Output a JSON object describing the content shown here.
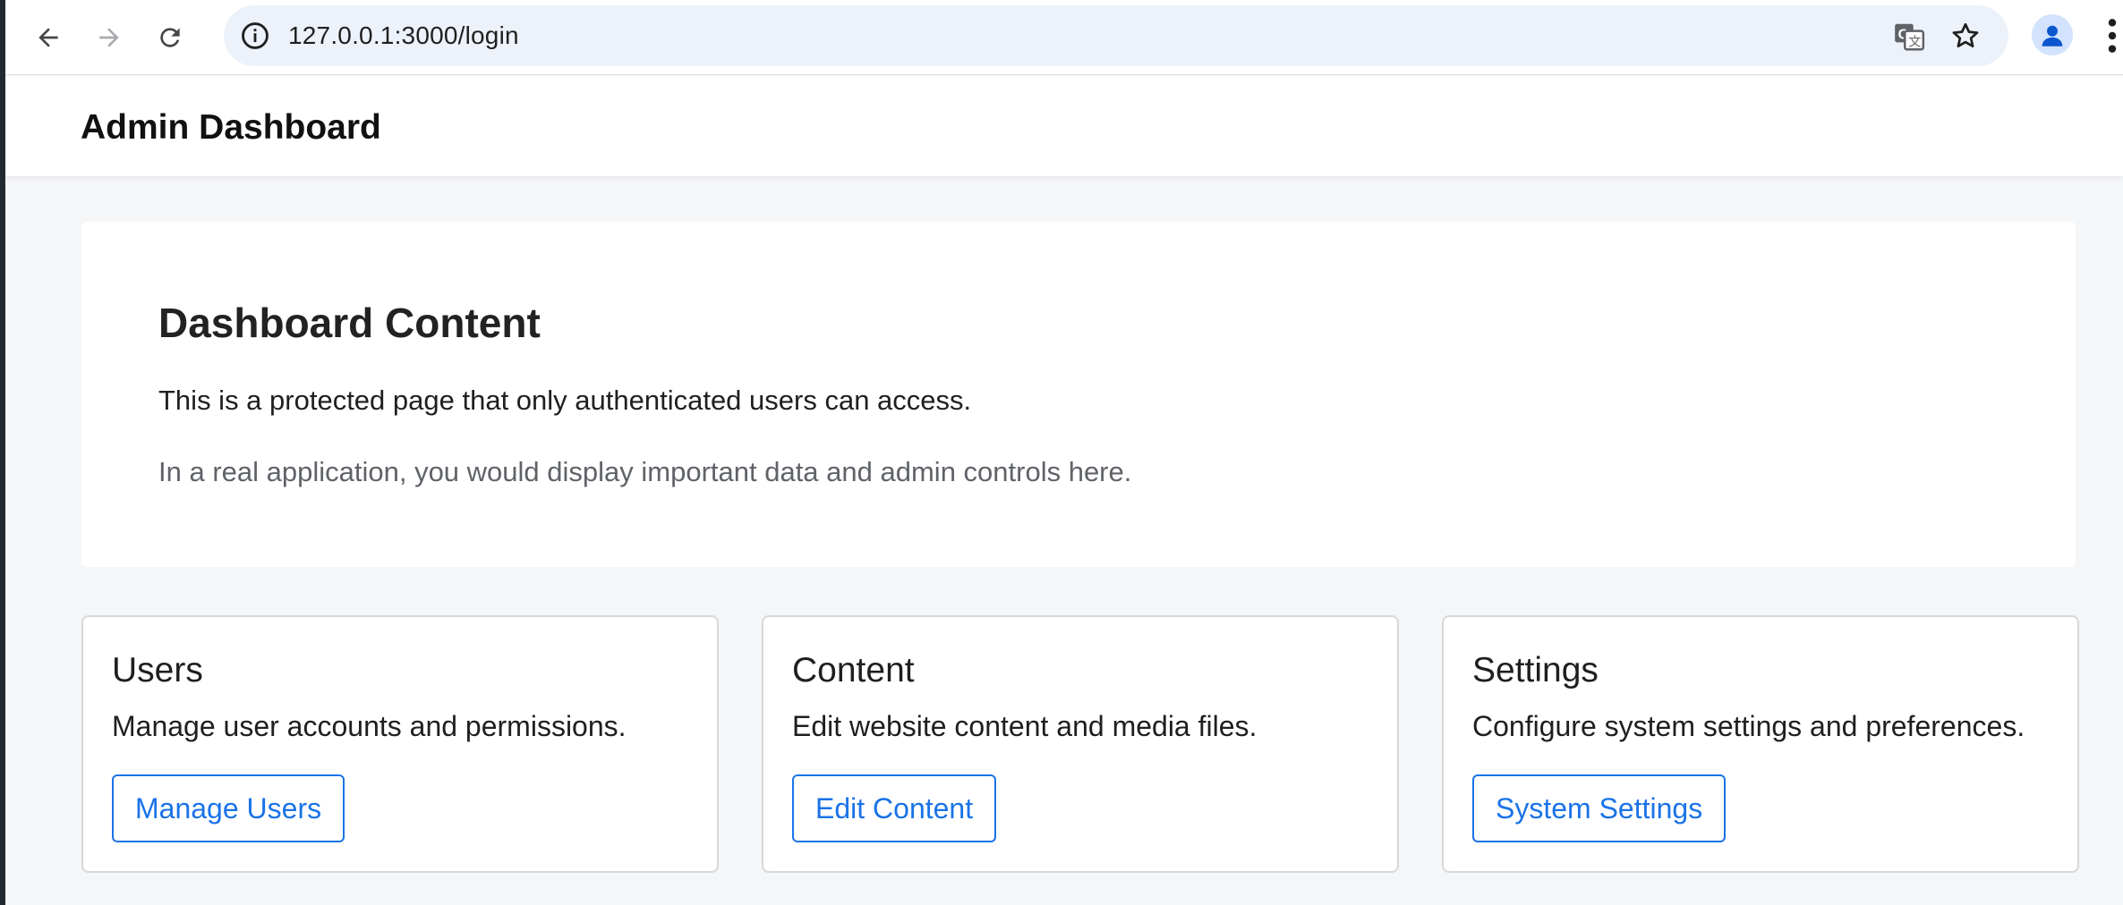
{
  "browser": {
    "url": "127.0.0.1:3000/login",
    "icons": [
      "back-icon",
      "forward-icon",
      "reload-icon",
      "info-icon",
      "translate-icon",
      "star-icon",
      "profile-icon",
      "menu-icon"
    ]
  },
  "header": {
    "title": "Admin Dashboard"
  },
  "main": {
    "heading": "Dashboard Content",
    "text_primary": "This is a protected page that only authenticated users can access.",
    "text_secondary": "In a real application, you would display important data and admin controls here."
  },
  "cards": [
    {
      "title": "Users",
      "description": "Manage user accounts and permissions.",
      "button": "Manage Users"
    },
    {
      "title": "Content",
      "description": "Edit website content and media files.",
      "button": "Edit Content"
    },
    {
      "title": "Settings",
      "description": "Configure system settings and preferences.",
      "button": "System Settings"
    }
  ],
  "colors": {
    "accent": "#1a73e8",
    "page_background": "#f5f6f8",
    "card_border": "#d5d7da"
  }
}
